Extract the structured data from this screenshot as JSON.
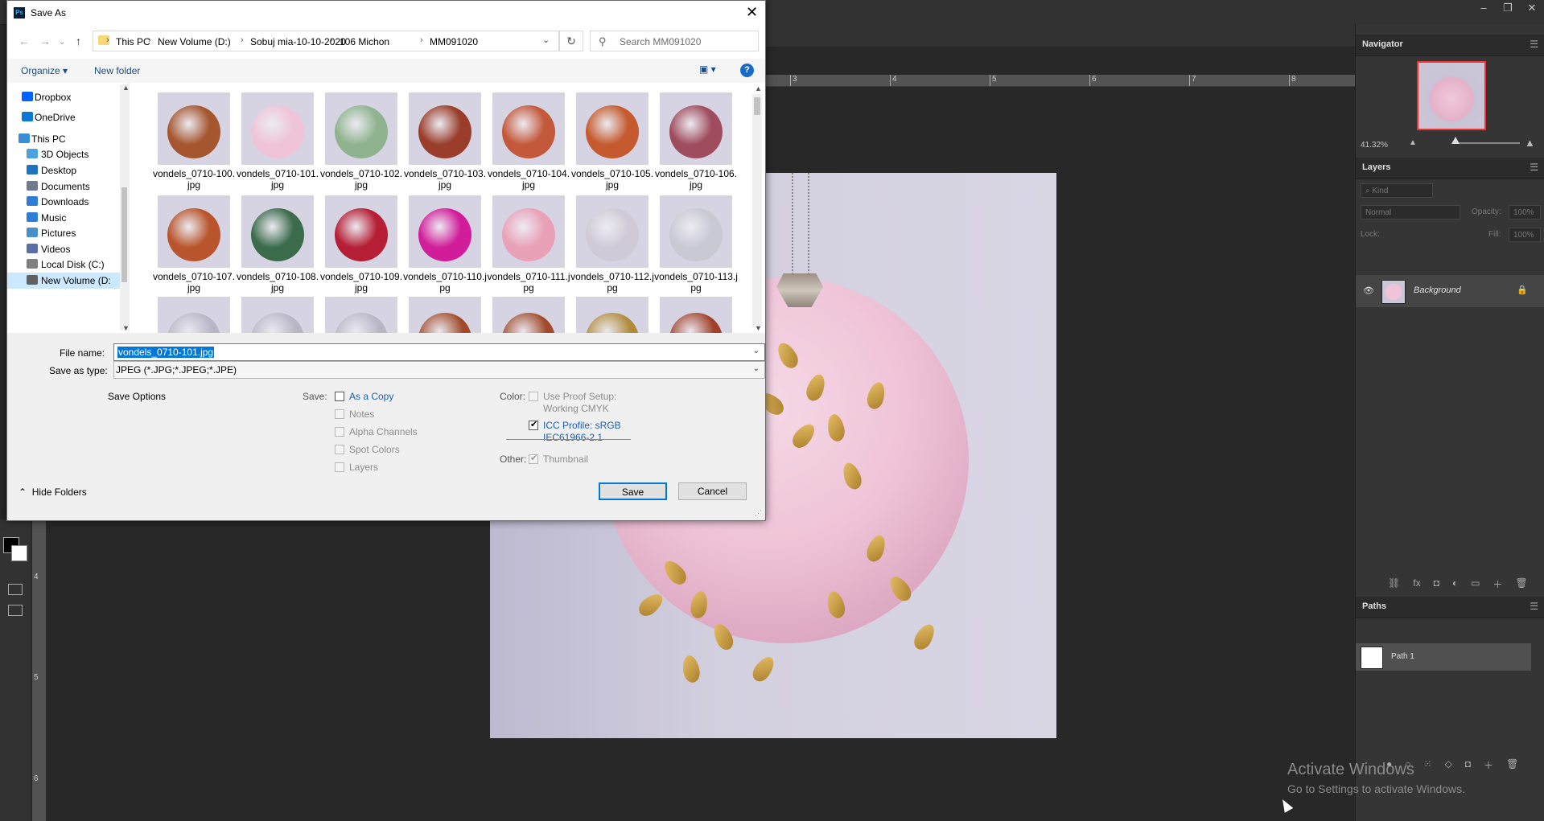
{
  "dialog": {
    "title": "Save As",
    "app_icon": "Ps",
    "close_glyph": "✕",
    "breadcrumb": [
      "This PC",
      "New Volume (D:)",
      "Sobuj mia-10-10-2020",
      "106 Michon",
      "MM091020"
    ],
    "search_placeholder": "Search MM091020",
    "organize_label": "Organize ▾",
    "new_folder_label": "New folder",
    "nav_items": [
      {
        "label": "Dropbox",
        "color": "#0061fe"
      },
      {
        "label": "OneDrive",
        "color": "#0a78d4"
      },
      {
        "label": "This PC",
        "color": "#3b8ed6"
      },
      {
        "label": "3D Objects",
        "color": "#4aa3df"
      },
      {
        "label": "Desktop",
        "color": "#1e73be"
      },
      {
        "label": "Documents",
        "color": "#6d7b8d"
      },
      {
        "label": "Downloads",
        "color": "#2e7dd6"
      },
      {
        "label": "Music",
        "color": "#2e7dd6"
      },
      {
        "label": "Pictures",
        "color": "#4a90c8"
      },
      {
        "label": "Videos",
        "color": "#5a6fa8"
      },
      {
        "label": "Local Disk (C:)",
        "color": "#808080"
      },
      {
        "label": "New Volume (D:",
        "color": "#606060"
      }
    ],
    "files": [
      {
        "name": "vondels_0710-100.jpg",
        "color": "#a5562e"
      },
      {
        "name": "vondels_0710-101.jpg",
        "color": "#efc4d8"
      },
      {
        "name": "vondels_0710-102.jpg",
        "color": "#8fb38e"
      },
      {
        "name": "vondels_0710-103.jpg",
        "color": "#9a3d2a"
      },
      {
        "name": "vondels_0710-104.jpg",
        "color": "#c4583a"
      },
      {
        "name": "vondels_0710-105.jpg",
        "color": "#c55a2e"
      },
      {
        "name": "vondels_0710-106.jpg",
        "color": "#9f4c5e"
      },
      {
        "name": "vondels_0710-107.jpg",
        "color": "#b8552c"
      },
      {
        "name": "vondels_0710-108.jpg",
        "color": "#3c6b4c"
      },
      {
        "name": "vondels_0710-109.jpg",
        "color": "#b51e35"
      },
      {
        "name": "vondels_0710-110.jpg",
        "color": "#d21d9a"
      },
      {
        "name": "vondels_0710-111.jpg",
        "color": "#e9a1b8"
      },
      {
        "name": "vondels_0710-112.jpg",
        "color": "#cfcbd6"
      },
      {
        "name": "vondels_0710-113.jpg",
        "color": "#c9c9d4"
      }
    ],
    "partial_row_colors": [
      "#b8b5c6",
      "#b8b5c6",
      "#b8b5c6",
      "#a04a2a",
      "#a04a2a",
      "#b08a3a",
      "#a0402a"
    ],
    "file_name_label": "File name:",
    "file_name_value": "vondels_0710-101.jpg",
    "save_as_type_label": "Save as type:",
    "save_as_type_value": "JPEG (*.JPG;*.JPEG;*.JPE)",
    "save_options_label": "Save Options",
    "save_label": "Save:",
    "save_opts": [
      {
        "label": "As a Copy",
        "checked": false,
        "disabled": false
      },
      {
        "label": "Notes",
        "checked": false,
        "disabled": true
      },
      {
        "label": "Alpha Channels",
        "checked": false,
        "disabled": true
      },
      {
        "label": "Spot Colors",
        "checked": false,
        "disabled": true
      },
      {
        "label": "Layers",
        "checked": false,
        "disabled": true
      }
    ],
    "color_label": "Color:",
    "use_proof_label": "Use Proof Setup:",
    "use_proof_sub": "Working CMYK",
    "icc_label": "ICC Profile:  sRGB",
    "icc_sub": "IEC61966-2.1",
    "other_label": "Other:",
    "thumbnail_label": "Thumbnail",
    "save_button": "Save",
    "cancel_button": "Cancel",
    "hide_folders": "Hide Folders"
  },
  "ps": {
    "ruler_top_labels": [
      "3",
      "4",
      "5",
      "6",
      "7",
      "8"
    ],
    "ruler_left_labels": [
      "4",
      "5",
      "6"
    ],
    "navigator_title": "Navigator",
    "zoom": "41.32%",
    "layers_title": "Layers",
    "kind_placeholder": "Kind",
    "blend_mode": "Normal",
    "opacity_label": "Opacity:",
    "opacity_value": "100%",
    "lock_label": "Lock:",
    "fill_label": "Fill:",
    "fill_value": "100%",
    "layer_name": "Background",
    "paths_title": "Paths",
    "path_name": "Path 1",
    "activate_title": "Activate Windows",
    "activate_sub": "Go to Settings to activate Windows."
  }
}
